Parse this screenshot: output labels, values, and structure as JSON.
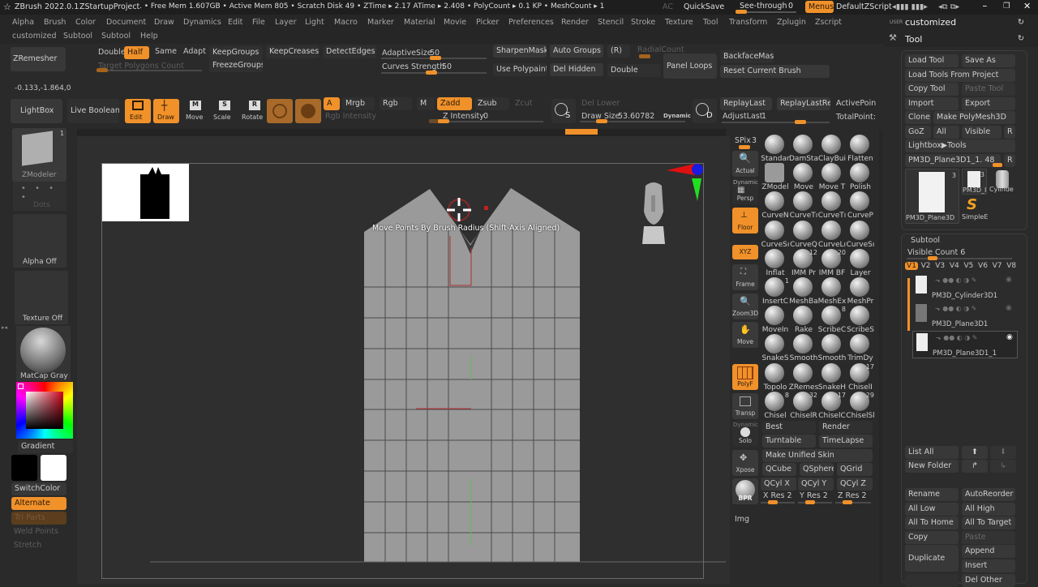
{
  "titlebar": {
    "app": "ZBrush 2022.0.1",
    "project": "ZStartupProject",
    "stats": ". • Free Mem 1.607GB • Active Mem 805 • Scratch Disk 49 •  ZTime ▸ 2.17 ATime ▸ 2.408 • PolyCount ▸ 0.1 KP • MeshCount ▸ 1",
    "ac": "AC",
    "quicksave": "QuickSave",
    "seethrough_label": "See-through",
    "seethrough_value": "0",
    "menus": "Menus",
    "default_zscript": "DefaultZScript"
  },
  "menubar": {
    "row1": [
      "Alpha",
      "Brush",
      "Color",
      "Document",
      "Draw",
      "Dynamics",
      "Edit",
      "File",
      "Layer",
      "Light",
      "Macro",
      "Marker",
      "Material",
      "Movie",
      "Picker",
      "Preferences",
      "Render",
      "Stencil",
      "Stroke",
      "Texture",
      "Tool",
      "Transform",
      "Zplugin",
      "Zscript"
    ],
    "row2": [
      "customized",
      "Subtool",
      "Subtool",
      "Help"
    ]
  },
  "right_header": {
    "user_prefix": "USER",
    "customized": "customized",
    "tool": "Tool"
  },
  "zremesher": {
    "zremesher": "ZRemesher",
    "double": "Double",
    "half": "Half",
    "same": "Same",
    "adapt": "Adapt",
    "keepgroups": "KeepGroups",
    "keepcreases": "KeepCreases",
    "detectedges": "DetectEdges",
    "target_polygons": "Target Polygons Count",
    "freezegroups": "FreezeGroups",
    "adaptive_size_label": "AdaptiveSize",
    "adaptive_size_value": "50",
    "curves_strength_label": "Curves Strength",
    "curves_strength_value": "50",
    "sharpenmask": "SharpenMask",
    "auto_groups": "Auto Groups",
    "r": "(R)",
    "radialcount": "RadialCount",
    "use_polypaint": "Use Polypaint",
    "del_hidden": "Del Hidden",
    "double2": "Double",
    "panel_loops": "Panel Loops",
    "backfacemask": "BackfaceMask",
    "reset_current_brush": "Reset Current Brush"
  },
  "coords": "-0.133,-1.864,0",
  "toolbar": {
    "lightbox": "LightBox",
    "live_boolean": "Live Boolean",
    "edit": "Edit",
    "draw": "Draw",
    "move": "Move",
    "scale": "Scale",
    "rotate": "Rotate",
    "a": "A",
    "mrgb": "Mrgb",
    "rgb": "Rgb",
    "m": "M",
    "zadd": "Zadd",
    "zsub": "Zsub",
    "zcut": "Zcut",
    "rgb_intensity": "Rgb Intensity",
    "z_intensity_label": "Z Intensity",
    "z_intensity_value": "0",
    "del_lower": "Del Lower",
    "draw_size_label": "Draw Size",
    "draw_size_value": "53.60782",
    "dynamic": "Dynamic",
    "s": "S",
    "d": "D",
    "replaylast": "ReplayLast",
    "replaylastrel": "ReplayLastRel",
    "activepoints": "ActivePoin",
    "adjustlast_label": "AdjustLast",
    "adjustlast_value": "1",
    "totalpoints": "TotalPoint:"
  },
  "left_panel": {
    "modeler": "ZModeler",
    "modeler_count": "1",
    "dots": "Dots",
    "alpha_off": "Alpha Off",
    "texture_off": "Texture Off",
    "matcap": "MatCap Gray",
    "gradient": "Gradient",
    "switchcolor": "SwitchColor",
    "alternate": "Alternate",
    "tri_parts": "Tri Parts",
    "weld_points": "Weld Points",
    "stretch": "Stretch"
  },
  "viewport": {
    "tooltip": "Move Points By Brush Radius (Shift-Axis Aligned)"
  },
  "right_tools": {
    "spix_label": "SPix",
    "spix_value": "3",
    "actual": "Actual",
    "persp": "Persp",
    "dynamic": "Dynamic",
    "floor": "Floor",
    "xyz": "XYZ",
    "frame": "Frame",
    "zoom3d": "Zoom3D",
    "move": "Move",
    "polyf": "PolyF",
    "transp": "Transp",
    "solo": "Solo",
    "xpose": "Xpose",
    "bpr": "BPR",
    "img": "Img"
  },
  "brushes": [
    [
      "Standar",
      "DamSta",
      "ClayBui",
      "Flatten"
    ],
    [
      "ZModel",
      "Move",
      "Move T",
      "Polish"
    ],
    [
      "CurveN",
      "CurveTı",
      "CurveTı",
      "CurveP"
    ],
    [
      "CurveSı",
      "CurveQ",
      "CurveLı",
      "CurveSı"
    ],
    [
      "Inflat",
      "IMM Pr",
      "IMM BF",
      "Layer"
    ],
    [
      "InsertC",
      "MeshBa",
      "MeshEx",
      "MeshPr"
    ],
    [
      "MoveIn",
      "Rake",
      "ScribeC",
      "ScribeS"
    ],
    [
      "SnakeS",
      "Smooth",
      "Smooth",
      "TrimDy"
    ],
    [
      "Topolo",
      "ZRemes",
      "SnakeH",
      "ChiselI"
    ],
    [
      "Chisel",
      "ChiselR",
      "ChiselC",
      "ChiselSl"
    ]
  ],
  "brush_counts": {
    "imm_pr": "12",
    "imm_bf": "20",
    "insertc": "1",
    "scribec": "8",
    "chisel3": "17",
    "chisel": "8",
    "chiselr": "32",
    "chiselc": "17",
    "chiselsl": "29"
  },
  "render_panel": {
    "best": "Best",
    "render": "Render",
    "turntable": "Turntable",
    "timelapse": "TimeLapse",
    "make_unified_skin": "Make Unified Skin",
    "qcube": "QCube",
    "qsphere": "QSphere",
    "qgrid": "QGrid",
    "qcylx": "QCyl X",
    "qcyly": "QCyl Y",
    "qcylz": "QCyl Z",
    "xres": "X Res 2",
    "yres": "Y Res 2",
    "zres": "Z Res 2"
  },
  "tool_panel": {
    "load_tool": "Load Tool",
    "save_as": "Save As",
    "load_from_project": "Load Tools From Project",
    "copy_tool": "Copy Tool",
    "paste_tool": "Paste Tool",
    "import": "Import",
    "export": "Export",
    "clone": "Clone",
    "make_polymesh": "Make PolyMesh3D",
    "goz": "GoZ",
    "all": "All",
    "visible": "Visible",
    "r": "R",
    "lightbox_tools": "Lightbox▶Tools",
    "current_tool": "PM3D_Plane3D1_1. 48",
    "thumb1": "PM3D_Plane3D",
    "thumb1_count": "3",
    "thumb2": "PM3D_I",
    "thumb2_count": "3",
    "thumb3": "Cylinde",
    "thumb4": "SimpleE"
  },
  "subtool_panel": {
    "title": "Subtool",
    "visible_count": "Visible Count 6",
    "versions": [
      "V1",
      "V2",
      "V3",
      "V4",
      "V5",
      "V6",
      "V7",
      "V8"
    ],
    "items": [
      "PM3D_Cylinder3D1",
      "PM3D_Plane3D1",
      "PM3D_Plane3D1_1"
    ],
    "list_all": "List All",
    "new_folder": "New Folder",
    "rename": "Rename",
    "autoreorder": "AutoReorder",
    "all_low": "All Low",
    "all_high": "All High",
    "all_to_home": "All To Home",
    "all_to_target": "All To Target",
    "copy": "Copy",
    "paste": "Paste",
    "duplicate": "Duplicate",
    "append": "Append",
    "insert": "Insert",
    "del_other": "Del Other"
  },
  "colors": {
    "accent": "#f0912a",
    "bg": "#2a2a2a",
    "mesh": "#9a9a9a"
  }
}
